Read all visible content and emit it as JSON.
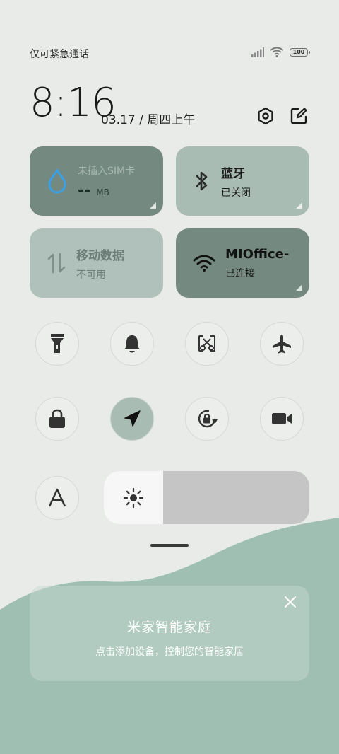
{
  "status_bar": {
    "carrier_text": "仅可紧急通话",
    "battery": "100"
  },
  "header": {
    "time": "8:16",
    "date": "03.17 / 周四上午"
  },
  "tiles": {
    "sim": {
      "title": "未插入SIM卡",
      "value": "--",
      "unit": "MB"
    },
    "bluetooth": {
      "title": "蓝牙",
      "status": "已关闭"
    },
    "mobile_data": {
      "title": "移动数据",
      "status": "不可用"
    },
    "wifi": {
      "title": "MIOffice-",
      "status": "已连接"
    }
  },
  "toggles": [
    {
      "icon": "flashlight-icon"
    },
    {
      "icon": "bell-icon"
    },
    {
      "icon": "screenshot-icon"
    },
    {
      "icon": "airplane-icon"
    },
    {
      "icon": "lock-icon"
    },
    {
      "icon": "location-icon",
      "active": true
    },
    {
      "icon": "rotation-lock-icon"
    },
    {
      "icon": "video-camera-icon"
    },
    {
      "icon": "font-size-icon",
      "label": "A"
    }
  ],
  "brightness": {
    "level_fraction": 0.29
  },
  "mijia_card": {
    "title": "米家智能家庭",
    "subtitle": "点击添加设备，控制您的智能家居"
  },
  "colors": {
    "tile_dark": "#748a80",
    "tile_light": "#a8bcb4",
    "wave": "#9ebfb2",
    "background": "#e8ebe8"
  }
}
